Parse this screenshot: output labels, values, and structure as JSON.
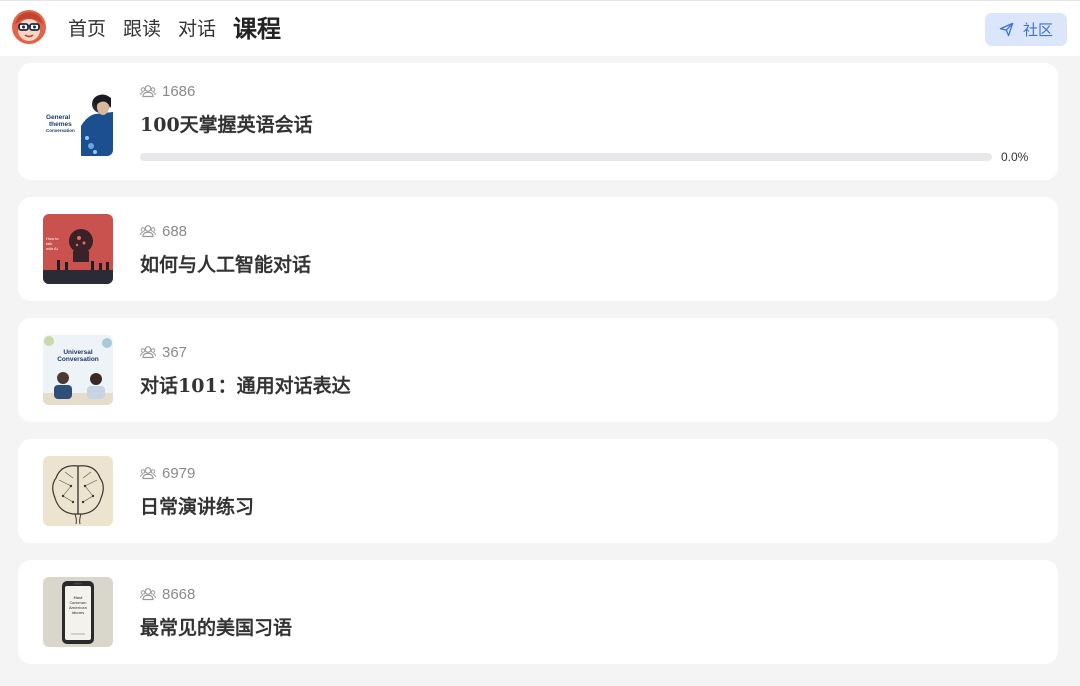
{
  "nav": {
    "items": [
      {
        "label": "首页",
        "active": false
      },
      {
        "label": "跟读",
        "active": false
      },
      {
        "label": "对话",
        "active": false
      },
      {
        "label": "课程",
        "active": true
      }
    ],
    "community_label": "社区"
  },
  "colors": {
    "accent": "#3f72d6",
    "accent_bg": "#dbe6fb",
    "page_bg": "#f4f4f5",
    "card_bg": "#ffffff"
  },
  "courses": [
    {
      "learners": "1686",
      "title": "100天掌握英语会话",
      "progress": 0.0,
      "progress_label": "0.0%",
      "thumb_icon": "general-themes-conversation-cover",
      "thumb_text": [
        "General",
        "themes",
        "Conversation"
      ]
    },
    {
      "learners": "688",
      "title": "如何与人工智能对话",
      "thumb_icon": "ai-conversation-cover",
      "thumb_text": [
        "How to",
        "talk",
        "with AI"
      ]
    },
    {
      "learners": "367",
      "title": "对话101：通用对话表达",
      "thumb_icon": "universal-conversation-cover",
      "thumb_text": [
        "Universal",
        "Conversation"
      ]
    },
    {
      "learners": "6979",
      "title": "日常演讲练习",
      "thumb_icon": "brain-sketch-cover"
    },
    {
      "learners": "8668",
      "title": "最常见的美国习语",
      "thumb_icon": "phone-idioms-cover",
      "thumb_text": [
        "Most",
        "Common",
        "American",
        "Idioms"
      ]
    }
  ]
}
